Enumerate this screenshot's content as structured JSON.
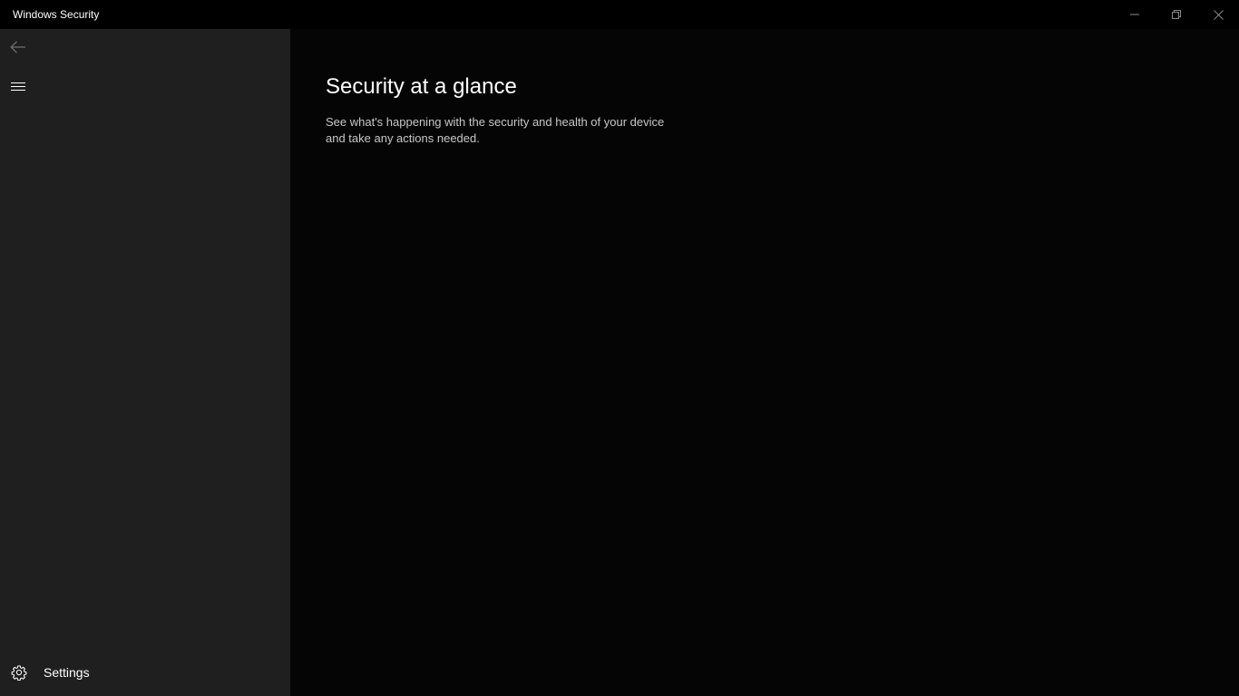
{
  "window": {
    "title": "Windows Security",
    "controls": {
      "minimize": "minimize-icon",
      "restore": "restore-icon",
      "close": "close-icon"
    }
  },
  "sidebar": {
    "back_icon": "back-arrow-icon",
    "menu_icon": "hamburger-menu-icon",
    "settings": {
      "icon": "gear-icon",
      "label": "Settings"
    }
  },
  "main": {
    "title": "Security at a glance",
    "description": "See what's happening with the security and health of your device and take any actions needed."
  },
  "colors": {
    "sidebar_bg": "#1f1f1f",
    "main_bg": "#050505",
    "titlebar_bg": "#000000",
    "text_primary": "#ffffff",
    "text_secondary": "#c8c8c8"
  }
}
